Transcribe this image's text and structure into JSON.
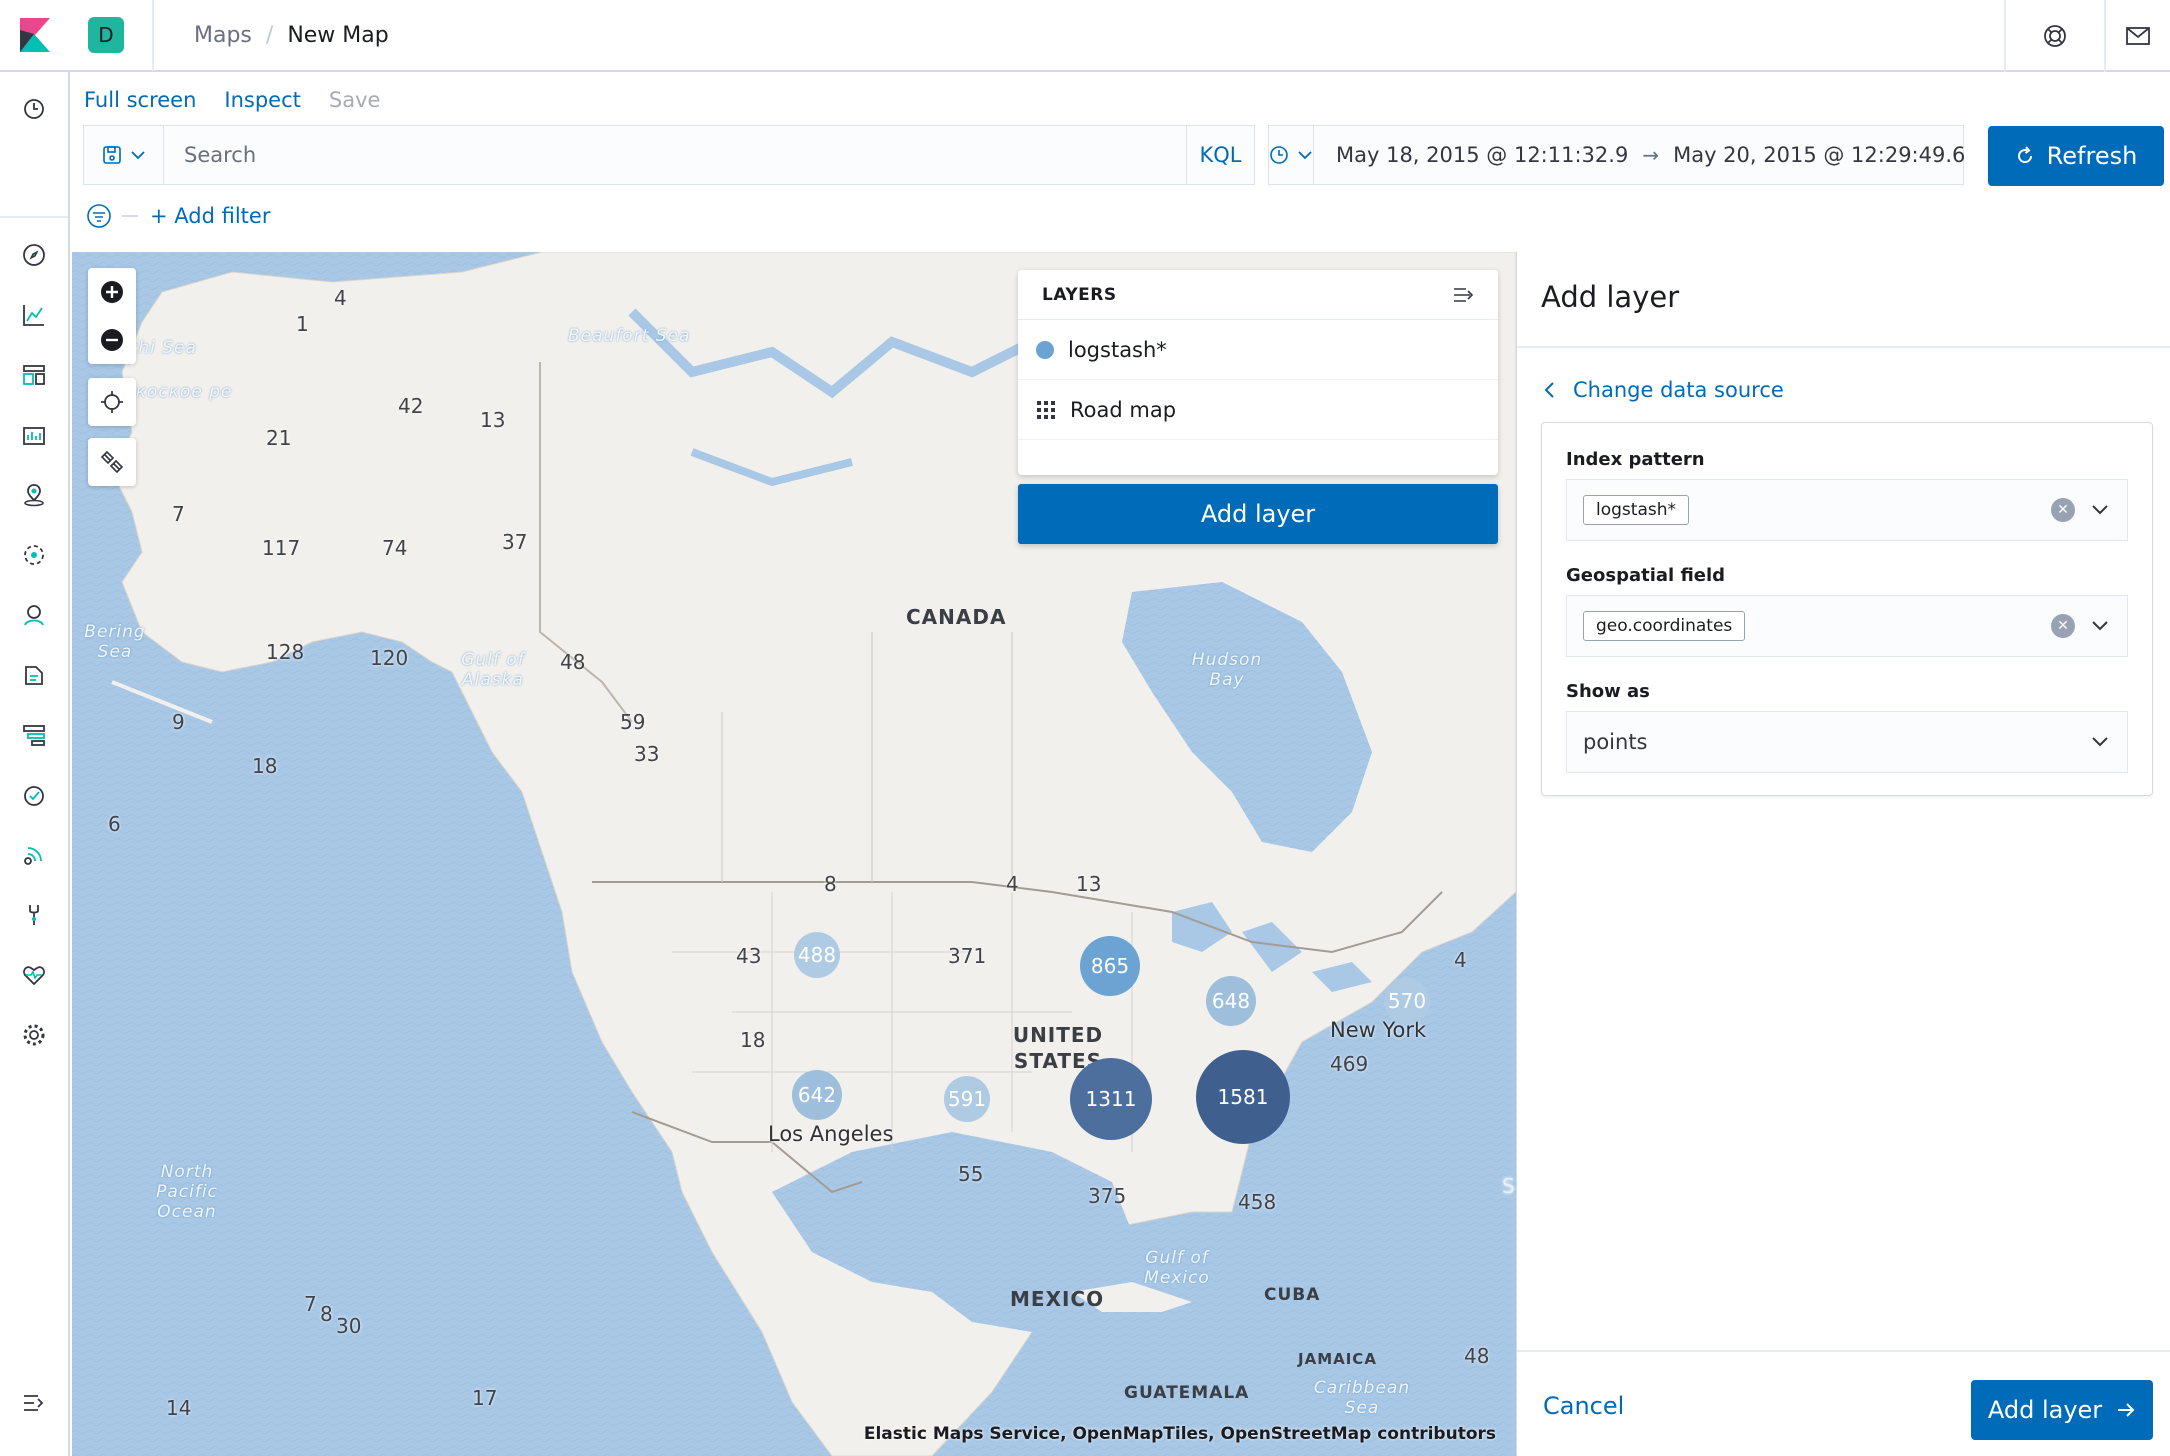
{
  "header": {
    "space_initial": "D",
    "breadcrumbs": [
      "Maps",
      "New Map"
    ],
    "breadcrumb_separator": "/"
  },
  "nav": {
    "icons": [
      "clock-icon",
      "compass-icon",
      "visualize-icon",
      "dashboard-icon",
      "canvas-icon",
      "maps-icon",
      "ml-icon",
      "infrastructure-icon",
      "logs-icon",
      "apm-icon",
      "uptime-icon",
      "graph-icon",
      "dev-tools-icon",
      "monitoring-icon",
      "management-icon",
      "collapse-icon"
    ]
  },
  "toolbar": {
    "full_screen": "Full screen",
    "inspect": "Inspect",
    "save": "Save"
  },
  "query": {
    "placeholder": "Search",
    "language": "KQL",
    "date_start": "May 18, 2015 @ 12:11:32.9",
    "date_arrow": "→",
    "date_end": "May 20, 2015 @ 12:29:49.6",
    "refresh_label": "Refresh",
    "add_filter": "+ Add filter"
  },
  "map": {
    "water_labels": [
      "Beaufort Sea",
      "Bering Sea",
      "Gulf of Alaska",
      "Hudson Bay",
      "North Pacific Ocean",
      "Gulf of Mexico",
      "Caribbean Sea",
      "chi Sea",
      "Чукоское ре"
    ],
    "country_labels": [
      "CANADA",
      "UNITED STATES",
      "MEXICO",
      "CUBA",
      "JAMAICA",
      "GUATEMALA"
    ],
    "city_labels": [
      "New York",
      "Los Angeles"
    ],
    "clusters": [
      {
        "value": "865"
      },
      {
        "value": "648"
      },
      {
        "value": "570"
      },
      {
        "value": "488"
      },
      {
        "value": "642"
      },
      {
        "value": "591"
      },
      {
        "value": "1311"
      },
      {
        "value": "1581"
      }
    ],
    "counts": [
      "4",
      "1",
      "42",
      "13",
      "21",
      "7",
      "117",
      "74",
      "37",
      "128",
      "120",
      "48",
      "59",
      "33",
      "9",
      "18",
      "6",
      "8",
      "4",
      "13",
      "43",
      "371",
      "18",
      "55",
      "375",
      "458",
      "469",
      "4",
      "48",
      "7",
      "8",
      "30",
      "14",
      "17"
    ],
    "attribution": "Elastic Maps Service, OpenMapTiles, OpenStreetMap contributors",
    "edge_glyph": "S"
  },
  "layers_panel": {
    "title": "LAYERS",
    "layers": [
      {
        "name": "logstash*",
        "color": "#6ba3d3"
      },
      {
        "name": "Road map"
      }
    ],
    "add_layer": "Add layer"
  },
  "flyout": {
    "title": "Add layer",
    "back_link": "Change data source",
    "index_pattern_label": "Index pattern",
    "index_pattern_value": "logstash*",
    "geo_field_label": "Geospatial field",
    "geo_field_value": "geo.coordinates",
    "show_as_label": "Show as",
    "show_as_value": "points",
    "cancel": "Cancel",
    "add_layer": "Add layer"
  },
  "colors": {
    "primary": "#006bb8",
    "cluster_light": "#6ba3d3",
    "cluster_dark": "#3f5f8f",
    "water": "#a8c8e6",
    "land": "#f2f0ec"
  }
}
